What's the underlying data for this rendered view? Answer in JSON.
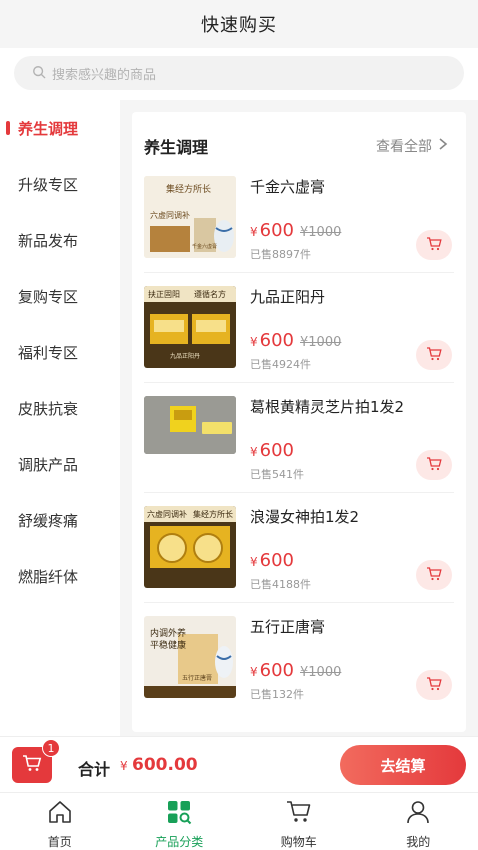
{
  "header": {
    "title": "快速购买"
  },
  "search": {
    "placeholder": "搜索感兴趣的商品",
    "icon": "search-icon"
  },
  "sidebar": {
    "active_index": 0,
    "items": [
      {
        "label": "养生调理"
      },
      {
        "label": "升级专区"
      },
      {
        "label": "新品发布"
      },
      {
        "label": "复购专区"
      },
      {
        "label": "福利专区"
      },
      {
        "label": "皮肤抗衰"
      },
      {
        "label": "调肤产品"
      },
      {
        "label": "舒缓疼痛"
      },
      {
        "label": "燃脂纤体"
      }
    ]
  },
  "panel": {
    "title": "养生调理",
    "view_all": "查看全部",
    "products": [
      {
        "name": "千金六虚膏",
        "currency": "¥",
        "price": "600",
        "original_price": "¥1000",
        "sold": "已售8897件",
        "thumb_text_1": "集经方所长",
        "thumb_text_2": "六虚同调补",
        "thumb_text_3": "千金六虚膏"
      },
      {
        "name": "九品正阳丹",
        "currency": "¥",
        "price": "600",
        "original_price": "¥1000",
        "sold": "已售4924件",
        "thumb_text_1": "扶正固阳",
        "thumb_text_2": "遵循名方",
        "thumb_text_3": "九品正阳丹"
      },
      {
        "name": "葛根黄精灵芝片拍1发2",
        "currency": "¥",
        "price": "600",
        "original_price": "",
        "sold": "已售541件"
      },
      {
        "name": "浪漫女神拍1发2",
        "currency": "¥",
        "price": "600",
        "original_price": "",
        "sold": "已售4188件",
        "thumb_text_1": "六虚同调补",
        "thumb_text_2": "集经方所长"
      },
      {
        "name": "五行正唐膏",
        "currency": "¥",
        "price": "600",
        "original_price": "¥1000",
        "sold": "已售132件",
        "thumb_text_1": "内调外养",
        "thumb_text_2": "平稳健康",
        "thumb_text_3": "五行正唐膏"
      }
    ]
  },
  "bottom_bar": {
    "cart_count": "1",
    "total_label": "合计",
    "total_currency": "¥",
    "total_value": "600.00",
    "checkout_label": "去结算"
  },
  "tabbar": {
    "active_index": 1,
    "items": [
      {
        "label": "首页",
        "icon": "home-icon"
      },
      {
        "label": "产品分类",
        "icon": "category-icon"
      },
      {
        "label": "购物车",
        "icon": "cart-icon"
      },
      {
        "label": "我的",
        "icon": "user-icon"
      }
    ]
  },
  "colors": {
    "accent": "#e4393c",
    "tab_active": "#18a058",
    "cart_btn_bg": "#fde8e6"
  }
}
